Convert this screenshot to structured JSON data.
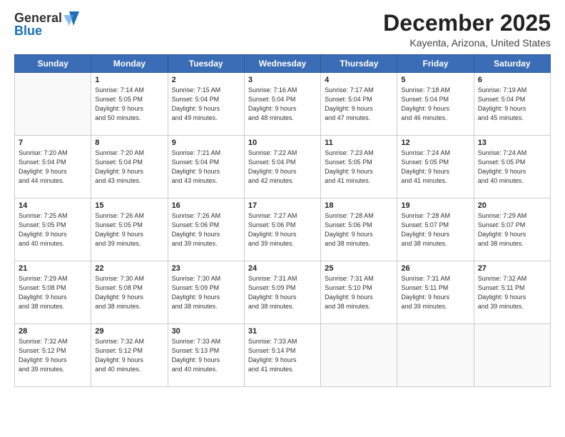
{
  "logo": {
    "general": "General",
    "blue": "Blue"
  },
  "title": "December 2025",
  "subtitle": "Kayenta, Arizona, United States",
  "weekdays": [
    "Sunday",
    "Monday",
    "Tuesday",
    "Wednesday",
    "Thursday",
    "Friday",
    "Saturday"
  ],
  "weeks": [
    [
      {
        "day": "",
        "info": ""
      },
      {
        "day": "1",
        "info": "Sunrise: 7:14 AM\nSunset: 5:05 PM\nDaylight: 9 hours\nand 50 minutes."
      },
      {
        "day": "2",
        "info": "Sunrise: 7:15 AM\nSunset: 5:04 PM\nDaylight: 9 hours\nand 49 minutes."
      },
      {
        "day": "3",
        "info": "Sunrise: 7:16 AM\nSunset: 5:04 PM\nDaylight: 9 hours\nand 48 minutes."
      },
      {
        "day": "4",
        "info": "Sunrise: 7:17 AM\nSunset: 5:04 PM\nDaylight: 9 hours\nand 47 minutes."
      },
      {
        "day": "5",
        "info": "Sunrise: 7:18 AM\nSunset: 5:04 PM\nDaylight: 9 hours\nand 46 minutes."
      },
      {
        "day": "6",
        "info": "Sunrise: 7:19 AM\nSunset: 5:04 PM\nDaylight: 9 hours\nand 45 minutes."
      }
    ],
    [
      {
        "day": "7",
        "info": "Sunrise: 7:20 AM\nSunset: 5:04 PM\nDaylight: 9 hours\nand 44 minutes."
      },
      {
        "day": "8",
        "info": "Sunrise: 7:20 AM\nSunset: 5:04 PM\nDaylight: 9 hours\nand 43 minutes."
      },
      {
        "day": "9",
        "info": "Sunrise: 7:21 AM\nSunset: 5:04 PM\nDaylight: 9 hours\nand 43 minutes."
      },
      {
        "day": "10",
        "info": "Sunrise: 7:22 AM\nSunset: 5:04 PM\nDaylight: 9 hours\nand 42 minutes."
      },
      {
        "day": "11",
        "info": "Sunrise: 7:23 AM\nSunset: 5:05 PM\nDaylight: 9 hours\nand 41 minutes."
      },
      {
        "day": "12",
        "info": "Sunrise: 7:24 AM\nSunset: 5:05 PM\nDaylight: 9 hours\nand 41 minutes."
      },
      {
        "day": "13",
        "info": "Sunrise: 7:24 AM\nSunset: 5:05 PM\nDaylight: 9 hours\nand 40 minutes."
      }
    ],
    [
      {
        "day": "14",
        "info": "Sunrise: 7:25 AM\nSunset: 5:05 PM\nDaylight: 9 hours\nand 40 minutes."
      },
      {
        "day": "15",
        "info": "Sunrise: 7:26 AM\nSunset: 5:05 PM\nDaylight: 9 hours\nand 39 minutes."
      },
      {
        "day": "16",
        "info": "Sunrise: 7:26 AM\nSunset: 5:06 PM\nDaylight: 9 hours\nand 39 minutes."
      },
      {
        "day": "17",
        "info": "Sunrise: 7:27 AM\nSunset: 5:06 PM\nDaylight: 9 hours\nand 39 minutes."
      },
      {
        "day": "18",
        "info": "Sunrise: 7:28 AM\nSunset: 5:06 PM\nDaylight: 9 hours\nand 38 minutes."
      },
      {
        "day": "19",
        "info": "Sunrise: 7:28 AM\nSunset: 5:07 PM\nDaylight: 9 hours\nand 38 minutes."
      },
      {
        "day": "20",
        "info": "Sunrise: 7:29 AM\nSunset: 5:07 PM\nDaylight: 9 hours\nand 38 minutes."
      }
    ],
    [
      {
        "day": "21",
        "info": "Sunrise: 7:29 AM\nSunset: 5:08 PM\nDaylight: 9 hours\nand 38 minutes."
      },
      {
        "day": "22",
        "info": "Sunrise: 7:30 AM\nSunset: 5:08 PM\nDaylight: 9 hours\nand 38 minutes."
      },
      {
        "day": "23",
        "info": "Sunrise: 7:30 AM\nSunset: 5:09 PM\nDaylight: 9 hours\nand 38 minutes."
      },
      {
        "day": "24",
        "info": "Sunrise: 7:31 AM\nSunset: 5:09 PM\nDaylight: 9 hours\nand 38 minutes."
      },
      {
        "day": "25",
        "info": "Sunrise: 7:31 AM\nSunset: 5:10 PM\nDaylight: 9 hours\nand 38 minutes."
      },
      {
        "day": "26",
        "info": "Sunrise: 7:31 AM\nSunset: 5:11 PM\nDaylight: 9 hours\nand 39 minutes."
      },
      {
        "day": "27",
        "info": "Sunrise: 7:32 AM\nSunset: 5:11 PM\nDaylight: 9 hours\nand 39 minutes."
      }
    ],
    [
      {
        "day": "28",
        "info": "Sunrise: 7:32 AM\nSunset: 5:12 PM\nDaylight: 9 hours\nand 39 minutes."
      },
      {
        "day": "29",
        "info": "Sunrise: 7:32 AM\nSunset: 5:12 PM\nDaylight: 9 hours\nand 40 minutes."
      },
      {
        "day": "30",
        "info": "Sunrise: 7:33 AM\nSunset: 5:13 PM\nDaylight: 9 hours\nand 40 minutes."
      },
      {
        "day": "31",
        "info": "Sunrise: 7:33 AM\nSunset: 5:14 PM\nDaylight: 9 hours\nand 41 minutes."
      },
      {
        "day": "",
        "info": ""
      },
      {
        "day": "",
        "info": ""
      },
      {
        "day": "",
        "info": ""
      }
    ]
  ]
}
